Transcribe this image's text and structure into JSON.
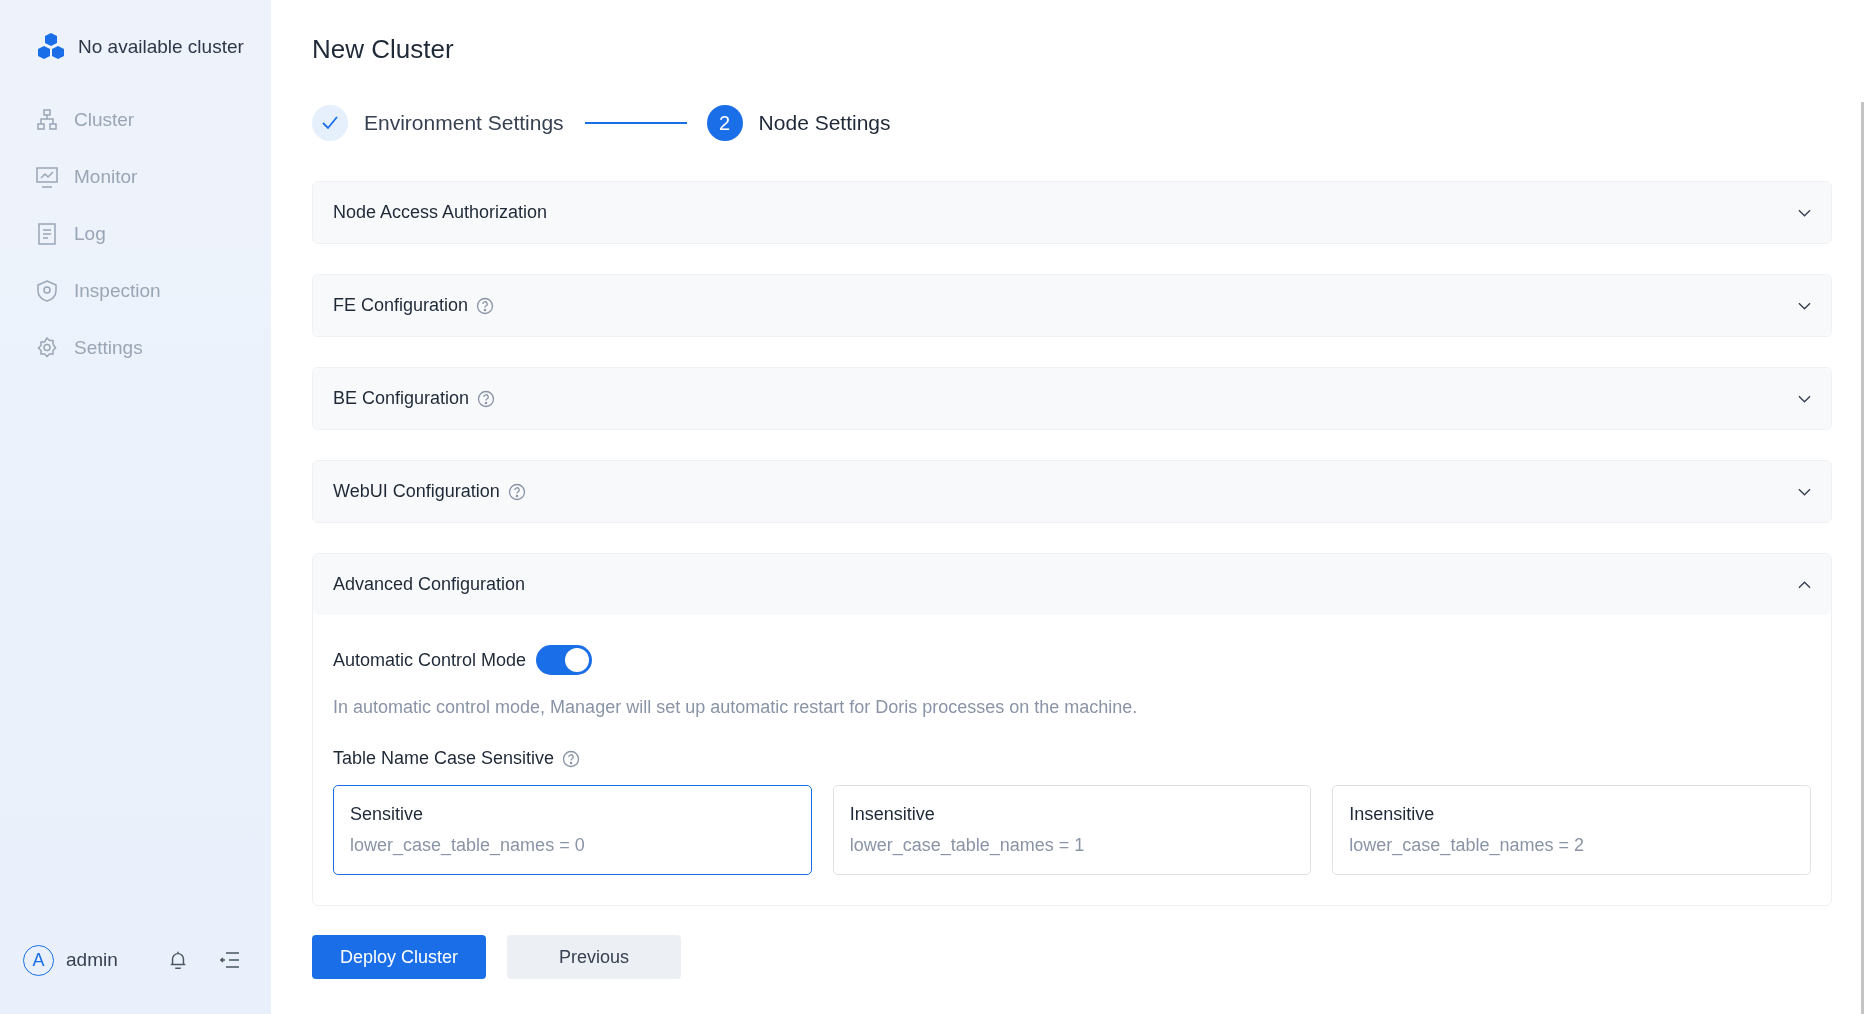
{
  "sidebar": {
    "cluster_name": "No available cluster",
    "items": [
      {
        "label": "Cluster",
        "disabled": true
      },
      {
        "label": "Monitor",
        "disabled": true
      },
      {
        "label": "Log",
        "disabled": true
      },
      {
        "label": "Inspection",
        "disabled": true
      },
      {
        "label": "Settings",
        "disabled": true
      }
    ],
    "user": {
      "avatar_letter": "A",
      "name": "admin"
    }
  },
  "page": {
    "title": "New Cluster"
  },
  "steps": [
    {
      "label": "Environment Settings",
      "completed": true
    },
    {
      "label": "Node Settings",
      "number": "2",
      "completed": false
    }
  ],
  "panels": [
    {
      "title": "Node Access Authorization",
      "help": false,
      "expanded": false
    },
    {
      "title": "FE Configuration",
      "help": true,
      "expanded": false
    },
    {
      "title": "BE Configuration",
      "help": true,
      "expanded": false
    },
    {
      "title": "WebUI Configuration",
      "help": true,
      "expanded": false
    },
    {
      "title": "Advanced Configuration",
      "help": false,
      "expanded": true
    }
  ],
  "advanced": {
    "toggle": {
      "label": "Automatic Control Mode",
      "on": true
    },
    "hint": "In automatic control mode, Manager will set up automatic restart for Doris processes on the machine.",
    "case_sensitivity": {
      "label": "Table Name Case Sensitive",
      "help": true,
      "options": [
        {
          "title": "Sensitive",
          "value": "lower_case_table_names = 0",
          "selected": true
        },
        {
          "title": "Insensitive",
          "value": "lower_case_table_names = 1",
          "selected": false
        },
        {
          "title": "Insensitive",
          "value": "lower_case_table_names = 2",
          "selected": false
        }
      ]
    }
  },
  "buttons": [
    {
      "label": "Deploy Cluster",
      "kind": "primary"
    },
    {
      "label": "Previous",
      "kind": "secondary"
    }
  ]
}
